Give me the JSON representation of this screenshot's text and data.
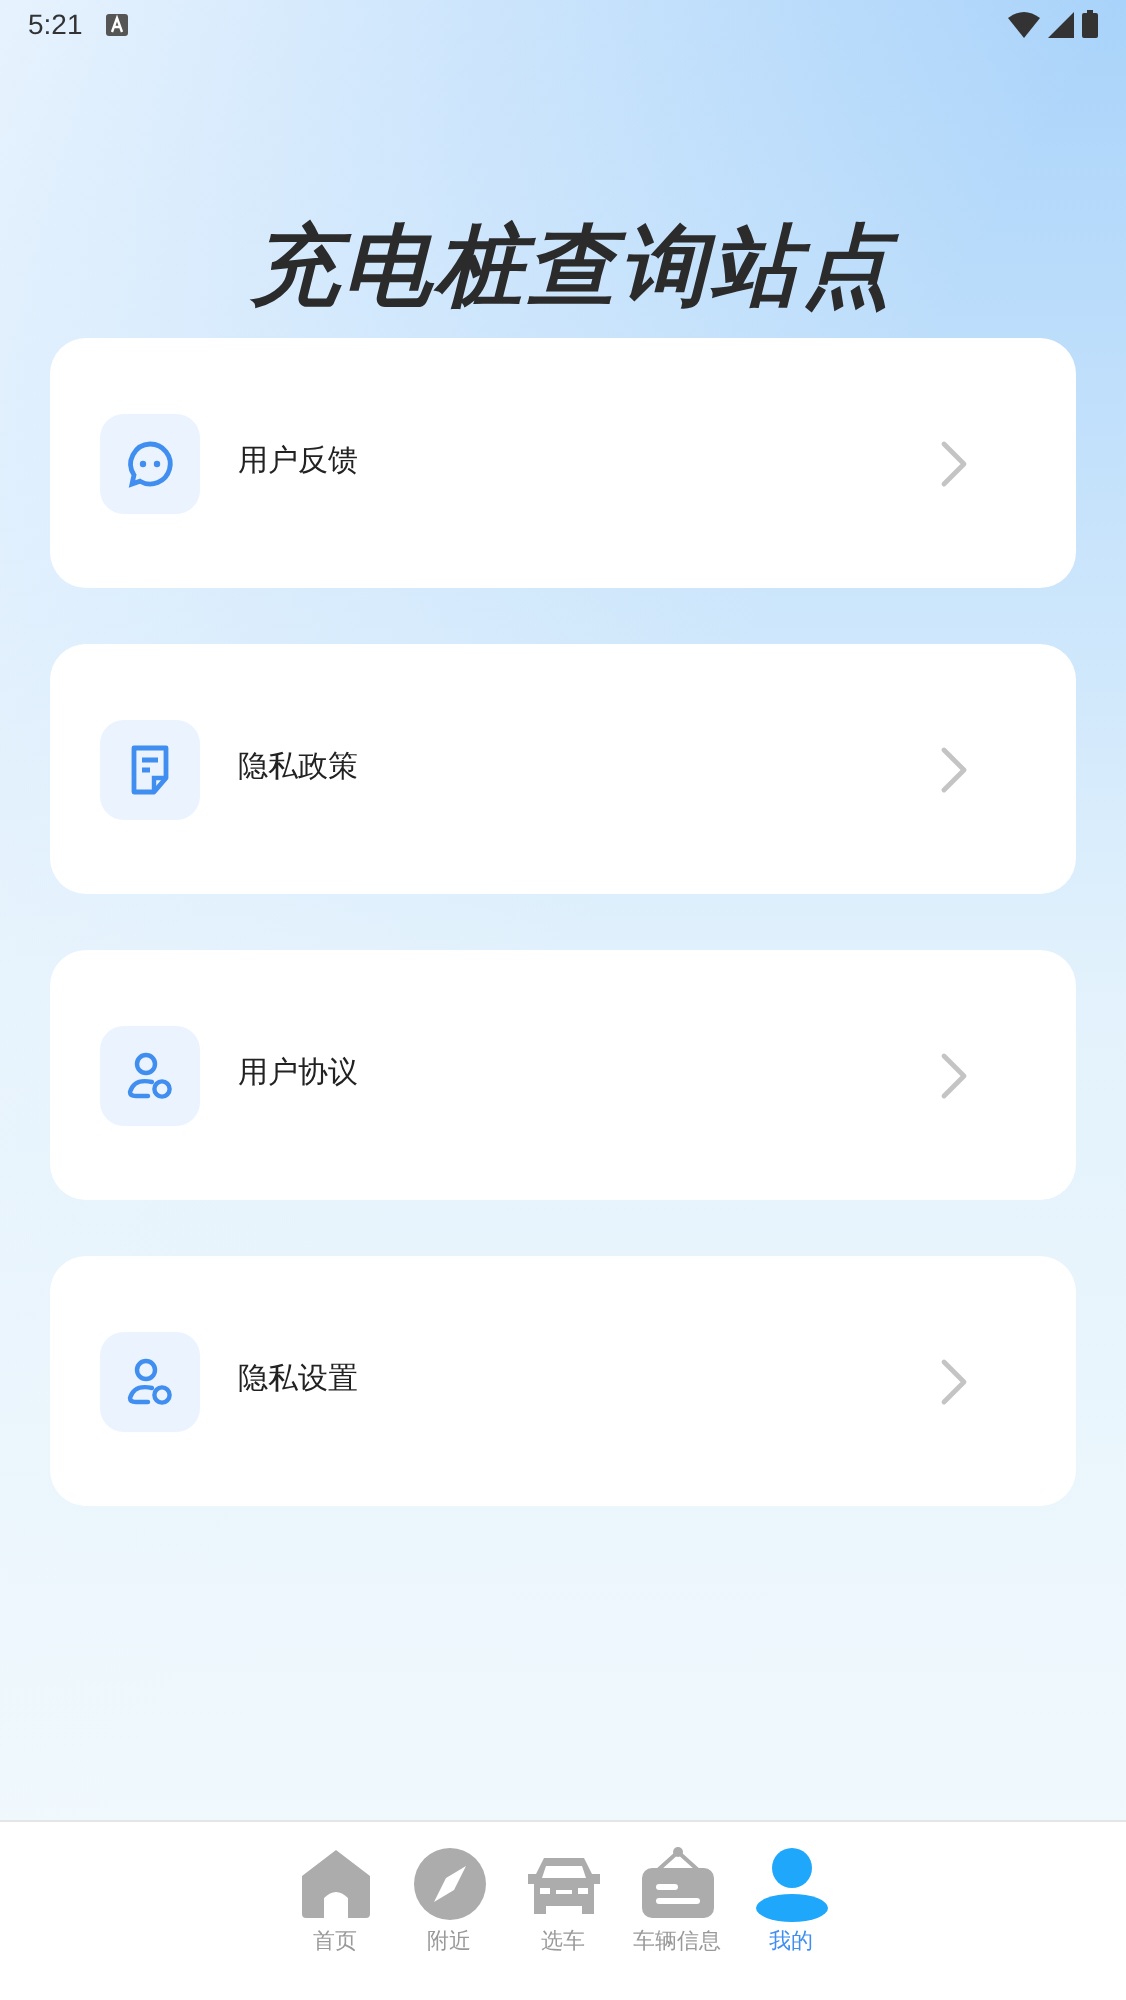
{
  "status_bar": {
    "time": "5:21"
  },
  "title": "充电桩查询站点",
  "menu": [
    {
      "label": "用户反馈",
      "kind": "chat"
    },
    {
      "label": "隐私政策",
      "kind": "document"
    },
    {
      "label": "用户协议",
      "kind": "user"
    },
    {
      "label": "隐私设置",
      "kind": "user"
    }
  ],
  "tab_bar": [
    {
      "label": "首页",
      "kind": "home",
      "selected": false
    },
    {
      "label": "附近",
      "kind": "compass",
      "selected": false
    },
    {
      "label": "选车",
      "kind": "car",
      "selected": false
    },
    {
      "label": "车辆信息",
      "kind": "sign",
      "selected": false
    },
    {
      "label": "我的",
      "kind": "person",
      "selected": true
    }
  ]
}
